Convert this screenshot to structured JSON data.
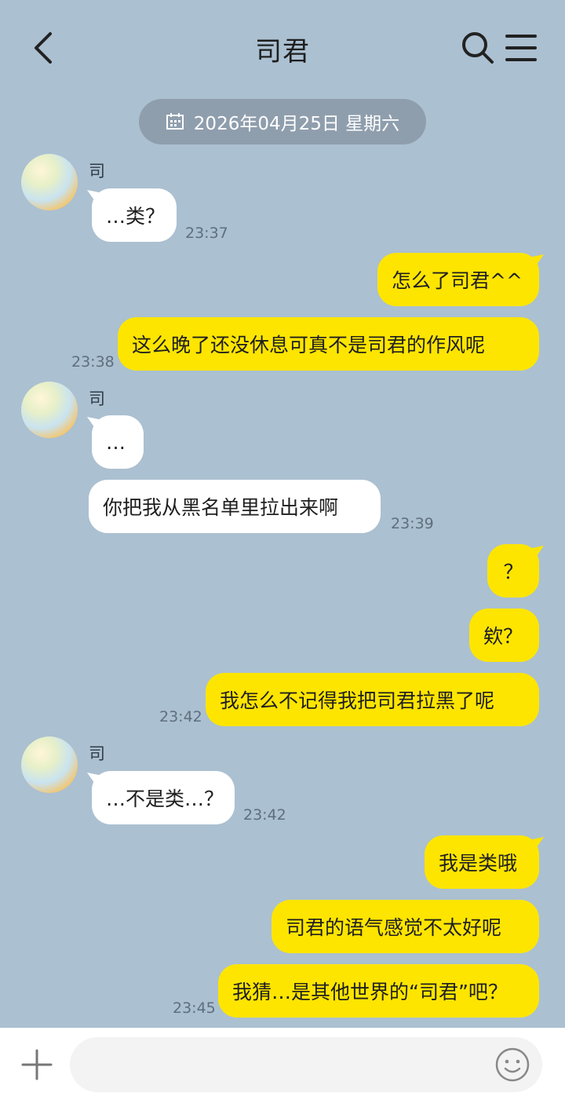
{
  "header": {
    "title": "司君",
    "back_icon": "chevron-left-icon",
    "search_icon": "search-icon",
    "menu_icon": "menu-icon"
  },
  "date_divider": {
    "icon": "calendar-icon",
    "text": "2026年04月25日 星期六"
  },
  "messages": [
    {
      "side": "in",
      "sender": "司",
      "text": "…类？",
      "time": "23:37"
    },
    {
      "side": "out",
      "text": "怎么了司君^^",
      "time": ""
    },
    {
      "side": "out",
      "text": "这么晚了还没休息可真不是司君的作风呢",
      "time": "23:38"
    },
    {
      "side": "in",
      "sender": "司",
      "text": "…",
      "time": ""
    },
    {
      "side": "in",
      "text": "你把我从黑名单里拉出来啊",
      "time": "23:39"
    },
    {
      "side": "out",
      "text": "？",
      "time": ""
    },
    {
      "side": "out",
      "text": "欸？",
      "time": ""
    },
    {
      "side": "out",
      "text": "我怎么不记得我把司君拉黑了呢",
      "time": "23:42"
    },
    {
      "side": "in",
      "sender": "司",
      "text": "…不是类…？",
      "time": "23:42"
    },
    {
      "side": "out",
      "text": "我是类哦",
      "time": ""
    },
    {
      "side": "out",
      "text": "司君的语气感觉不太好呢",
      "time": ""
    },
    {
      "side": "out",
      "text": "我猜…是其他世界的“司君”吧？",
      "time": "23:45"
    }
  ],
  "input": {
    "value": "",
    "plus_icon": "plus-icon",
    "emoji_icon": "emoji-icon"
  },
  "colors": {
    "background": "#abc0d1",
    "outgoing_bubble": "#fee500",
    "incoming_bubble": "#ffffff",
    "date_pill": "#8f9ead"
  }
}
